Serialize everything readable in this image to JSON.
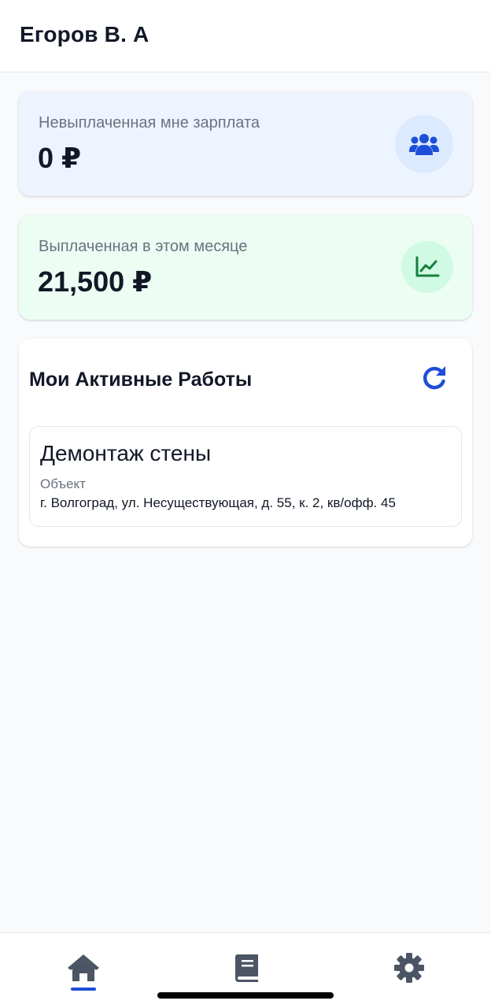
{
  "header": {
    "title": "Егоров В. А"
  },
  "stats": [
    {
      "label": "Невыплаченная мне зарплата",
      "value": "0 ₽",
      "icon": "users-icon",
      "color": "#1d4ed8"
    },
    {
      "label": "Выплаченная в этом месяце",
      "value": "21,500 ₽",
      "icon": "chart-line-icon",
      "color": "#15803d"
    }
  ],
  "jobs": {
    "title": "Мои Активные Работы",
    "refresh_icon": "refresh-icon",
    "items": [
      {
        "title": "Демонтаж стены",
        "object_label": "Объект",
        "address": "г. Волгоград, ул. Несуществующая, д. 55, к. 2, кв/офф. 45"
      }
    ]
  },
  "tabbar": {
    "tabs": [
      {
        "id": "home",
        "icon": "home-icon",
        "active": true
      },
      {
        "id": "book",
        "icon": "book-icon",
        "active": false
      },
      {
        "id": "settings",
        "icon": "gear-icon",
        "active": false
      }
    ],
    "active_color": "#1d4ed8",
    "inactive_color": "#4b5563"
  }
}
